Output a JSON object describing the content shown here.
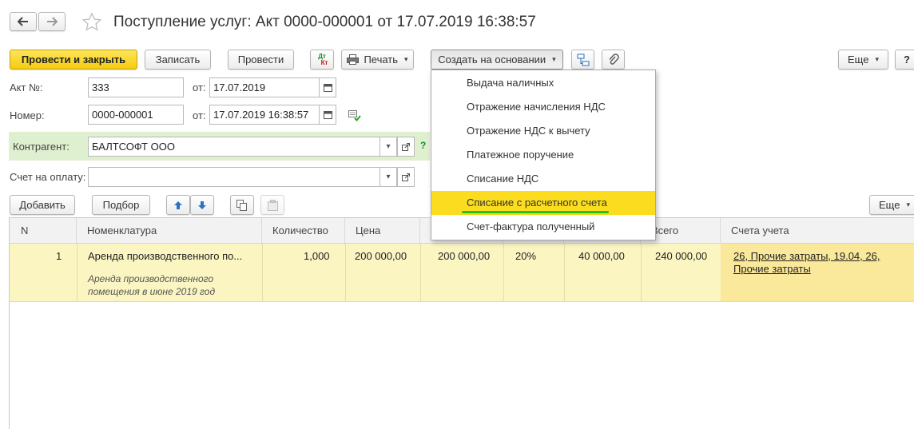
{
  "window": {
    "title": "Поступление услуг: Акт 0000-000001 от 17.07.2019 16:38:57"
  },
  "nav": {
    "back_icon": "arrow-left-icon",
    "forward_icon": "arrow-right-icon",
    "favorite_icon": "star-icon"
  },
  "toolbar": {
    "post_close": "Провести и закрыть",
    "save": "Записать",
    "post": "Провести",
    "dt_kt_top": "Дт",
    "dt_kt_bottom": "Кт",
    "print": "Печать",
    "create_based": "Создать на основании",
    "more": "Еще",
    "help": "?"
  },
  "form": {
    "act_label": "Акт №:",
    "act_value": "333",
    "from_label_1": "от:",
    "act_date": "17.07.2019",
    "number_label": "Номер:",
    "number_value": "0000-000001",
    "from_label_2": "от:",
    "number_date": "17.07.2019 16:38:57",
    "counterparty_label": "Контрагент:",
    "counterparty_value": "БАЛТСОФТ ООО",
    "counterparty_help": "?",
    "invoice_label": "Счет на оплату:",
    "invoice_value": ""
  },
  "table_toolbar": {
    "add": "Добавить",
    "pick": "Подбор",
    "more": "Еще"
  },
  "table": {
    "headers": {
      "n": "N",
      "nomenclature": "Номенклатура",
      "quantity": "Количество",
      "price": "Цена",
      "total": "Всего",
      "accounts": "Счета учета"
    },
    "row": {
      "n": "1",
      "nomenclature": "Аренда производственного по...",
      "description_1": "Аренда производственного",
      "description_2": "помещения в июне 2019 год",
      "quantity": "1,000",
      "price": "200 000,00",
      "sum": "200 000,00",
      "vat_rate": "20%",
      "vat_sum": "40 000,00",
      "total": "240 000,00",
      "accounts_1": "26, Прочие затраты, 19.04, 26,",
      "accounts_2": "Прочие затраты"
    }
  },
  "dropdown": {
    "items": [
      "Выдача наличных",
      "Отражение начисления НДС",
      "Отражение НДС к вычету",
      "Платежное поручение",
      "Списание НДС",
      "Списание с расчетного счета",
      "Счет-фактура полученный"
    ],
    "selected_index": 5
  },
  "colors": {
    "primary_button": "#f5cc10",
    "selected_item": "#fbdc1e",
    "row_highlight": "#fbf5c2",
    "counterparty_bg": "#dff0d0",
    "underline_mark": "#22c41a"
  }
}
